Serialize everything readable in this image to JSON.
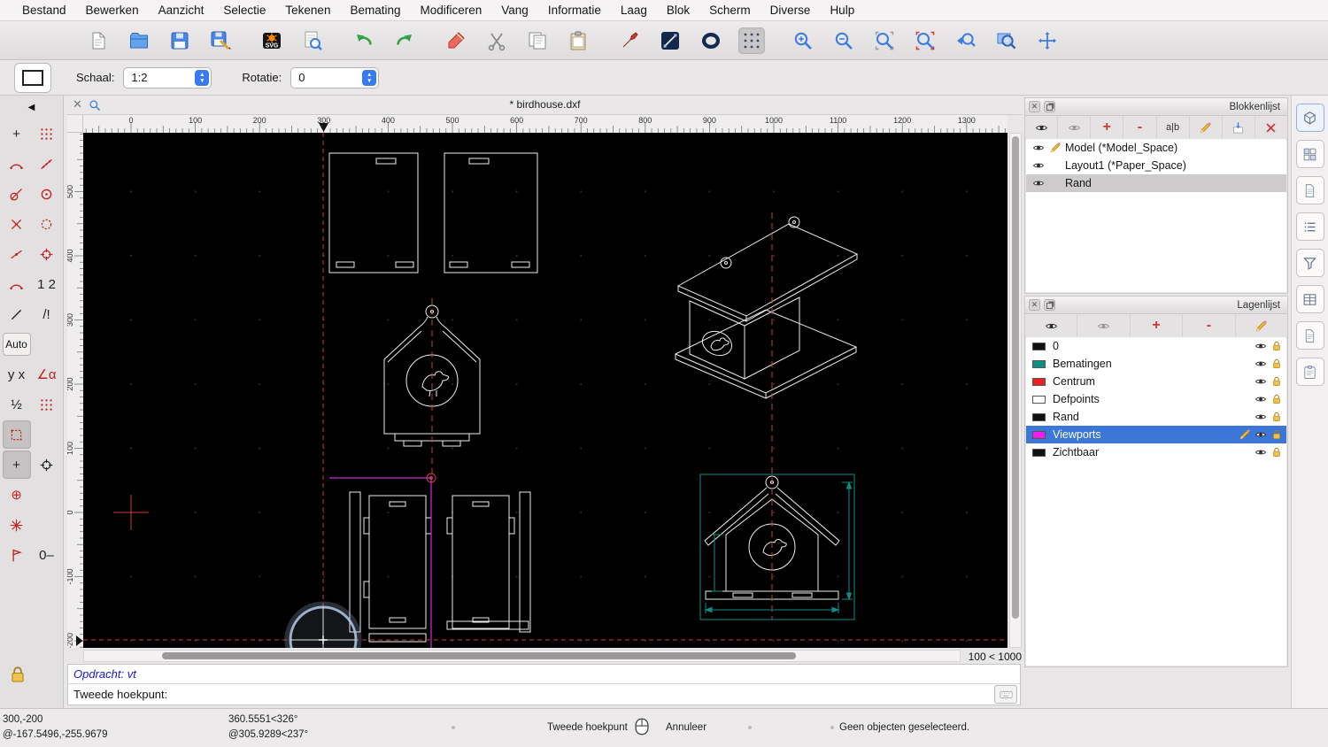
{
  "colors": {
    "accent": "#3a7af0",
    "selection_blue": "#3b76d8",
    "selection_gray": "#cdcbcb",
    "canvas_bg": "#000000",
    "entity_white": "#ededed",
    "centerline_red": "#d23b3b",
    "viewport_magenta": "#cc2fd4",
    "dimension_teal": "#0e8f84"
  },
  "menubar": {
    "items": [
      "Bestand",
      "Bewerken",
      "Aanzicht",
      "Selectie",
      "Tekenen",
      "Bemating",
      "Modificeren",
      "Vang",
      "Informatie",
      "Laag",
      "Blok",
      "Scherm",
      "Diverse",
      "Hulp"
    ]
  },
  "toolbar": {
    "buttons": [
      {
        "name": "new-file",
        "icon": "page"
      },
      {
        "name": "open-file",
        "icon": "folder"
      },
      {
        "name": "save-file",
        "icon": "floppy"
      },
      {
        "name": "save-as",
        "icon": "floppypen"
      },
      {
        "name": "export-svg",
        "icon": "svgbadge",
        "sep": true
      },
      {
        "name": "print-preview",
        "icon": "preview"
      },
      {
        "name": "undo",
        "icon": "undo",
        "sep": true
      },
      {
        "name": "redo",
        "icon": "redo"
      },
      {
        "name": "draw-highlight",
        "icon": "penred",
        "sep": true
      },
      {
        "name": "cut",
        "icon": "scissors"
      },
      {
        "name": "copy",
        "icon": "copy"
      },
      {
        "name": "paste",
        "icon": "clipboard"
      },
      {
        "name": "pen-tool",
        "icon": "pen2",
        "sep": true
      },
      {
        "name": "line-tool",
        "icon": "linebox"
      },
      {
        "name": "ellipse-tool",
        "icon": "ellipsebox"
      },
      {
        "name": "grid-toggle",
        "icon": "griddots",
        "active": true
      },
      {
        "name": "zoom-in",
        "icon": "zoomin",
        "sep": true
      },
      {
        "name": "zoom-out",
        "icon": "zoomout"
      },
      {
        "name": "zoom-auto",
        "icon": "zoomfit"
      },
      {
        "name": "zoom-reference",
        "icon": "zoomref"
      },
      {
        "name": "zoom-previous",
        "icon": "zoomprev"
      },
      {
        "name": "zoom-window",
        "icon": "zoomwin"
      },
      {
        "name": "pan",
        "icon": "pan"
      }
    ]
  },
  "options_bar": {
    "scale_label": "Schaal:",
    "scale_value": "1:2",
    "rotation_label": "Rotatie:",
    "rotation_value": "0"
  },
  "palette": {
    "back_arrow": "◀",
    "cells": [
      {
        "name": "snap-free",
        "text": "+",
        "color": "black"
      },
      {
        "name": "snap-grid",
        "icon": "p-dots",
        "color": "red"
      },
      {
        "name": "snap-endpoint",
        "icon": "p-arc",
        "color": "red"
      },
      {
        "name": "snap-on-entity",
        "icon": "p-entity",
        "color": "red"
      },
      {
        "name": "snap-perpendicular",
        "icon": "p-tangent",
        "color": "red"
      },
      {
        "name": "snap-center",
        "icon": "p-circledot",
        "color": "red"
      },
      {
        "name": "snap-intersection",
        "icon": "p-cross",
        "color": "red"
      },
      {
        "name": "snap-distance",
        "icon": "p-dashcircle",
        "color": "red"
      },
      {
        "name": "snap-middle",
        "icon": "p-middot",
        "color": "red"
      },
      {
        "name": "snap-coordinate",
        "icon": "p-target",
        "color": "red"
      },
      {
        "name": "restrict-nothing",
        "icon": "p-arc",
        "color": "red"
      },
      {
        "name": "snap-order",
        "text": "1 2",
        "color": "black"
      },
      {
        "name": "snap-filter",
        "icon": "p-slash",
        "color": "black"
      },
      {
        "name": "snap-exclude",
        "text": "/!",
        "color": "black"
      },
      {
        "name": "auto-snap",
        "text": "Auto",
        "auto": true
      },
      {
        "name": "spacer-1",
        "spacer": true
      },
      {
        "name": "coord-cartesian",
        "text": "y x",
        "color": "black"
      },
      {
        "name": "coord-polar",
        "text": "∠α",
        "color": "red"
      },
      {
        "name": "unit-fraction",
        "text": "½",
        "color": "black"
      },
      {
        "name": "grid-points",
        "icon": "p-dots",
        "color": "red"
      },
      {
        "name": "select-region",
        "icon": "p-dashsquare",
        "color": "red",
        "active": true
      },
      {
        "name": "spacer-2",
        "spacer": true
      },
      {
        "name": "tool-plus",
        "text": "+",
        "color": "black",
        "active": true
      },
      {
        "name": "tool-crosshair",
        "icon": "p-target",
        "color": "black"
      },
      {
        "name": "tool-circle-plus",
        "text": "⊕",
        "color": "red"
      },
      {
        "name": "spacer-3",
        "spacer": true
      },
      {
        "name": "tool-rays",
        "icon": "p-star",
        "color": "red"
      },
      {
        "name": "spacer-4",
        "spacer": true
      },
      {
        "name": "tool-flag",
        "icon": "p-flag",
        "color": "red"
      },
      {
        "name": "tool-zero-lock",
        "text": "0–",
        "color": "black"
      }
    ]
  },
  "document": {
    "title": "* birdhouse.dxf"
  },
  "rulers": {
    "horizontal": [
      "0",
      "100",
      "200",
      "300",
      "400",
      "500",
      "600",
      "700",
      "800",
      "900",
      "1000",
      "1100",
      "1200",
      "1300"
    ],
    "vertical": [
      "500",
      "400",
      "300",
      "200",
      "100",
      "0",
      "-100",
      "-200"
    ]
  },
  "canvas": {
    "zoom_indicator": "100 < 1000"
  },
  "command_line": {
    "history": "Opdracht: vt",
    "prompt": "Tweede hoekpunt:"
  },
  "status_bar": {
    "abs_coord": "300,-200",
    "rel_coord": "@-167.5496,-255.9679",
    "polar_abs": "360.5551<326°",
    "polar_rel": "@305.9289<237°",
    "mouse_left_action": "Tweede hoekpunt",
    "mouse_right_action": "Annuleer",
    "selection_status": "Geen objecten geselecteerd."
  },
  "block_list": {
    "title": "Blokkenlijst",
    "toolbar": [
      {
        "name": "show-all-blocks",
        "icon": "eye"
      },
      {
        "name": "hide-all-blocks",
        "icon": "eyegray"
      },
      {
        "name": "add-block",
        "text": "+",
        "red": true
      },
      {
        "name": "remove-block",
        "text": "-",
        "red": true
      },
      {
        "name": "rename-block",
        "text": "a|b"
      },
      {
        "name": "edit-block",
        "icon": "pencil"
      },
      {
        "name": "insert-block",
        "icon": "insert"
      },
      {
        "name": "delete-block",
        "icon": "xred"
      }
    ],
    "items": [
      {
        "name": "Model (*Model_Space)",
        "editable": true,
        "selected": false
      },
      {
        "name": "Layout1 (*Paper_Space)",
        "editable": false,
        "selected": false
      },
      {
        "name": "Rand",
        "editable": false,
        "selected": true
      }
    ]
  },
  "layer_list": {
    "title": "Lagenlijst",
    "toolbar": [
      {
        "name": "show-all-layers",
        "icon": "eye"
      },
      {
        "name": "hide-all-layers",
        "icon": "eyegray"
      },
      {
        "name": "add-layer",
        "text": "+",
        "red": true
      },
      {
        "name": "remove-layer",
        "text": "-",
        "red": true
      },
      {
        "name": "edit-layer",
        "icon": "pencil"
      }
    ],
    "layers": [
      {
        "name": "0",
        "color": "#111111",
        "selected": false,
        "editable": false
      },
      {
        "name": "Bematingen",
        "color": "#0e8f84",
        "selected": false,
        "editable": false
      },
      {
        "name": "Centrum",
        "color": "#e82222",
        "selected": false,
        "editable": false
      },
      {
        "name": "Defpoints",
        "color": "#ffffff",
        "selected": false,
        "editable": false
      },
      {
        "name": "Rand",
        "color": "#111111",
        "selected": false,
        "editable": false
      },
      {
        "name": "Viewports",
        "color": "#f31df3",
        "selected": true,
        "editable": true
      },
      {
        "name": "Zichtbaar",
        "color": "#111111",
        "selected": false,
        "editable": false
      }
    ]
  },
  "right_strip": {
    "buttons": [
      {
        "name": "toggle-library-browser",
        "icon": "cube"
      },
      {
        "name": "toggle-block-list",
        "icon": "blocks"
      },
      {
        "name": "toggle-command-history",
        "icon": "sheet"
      },
      {
        "name": "toggle-layer-list",
        "icon": "list"
      },
      {
        "name": "toggle-selection-filter",
        "icon": "funnel"
      },
      {
        "name": "toggle-property-editor",
        "icon": "columns"
      },
      {
        "name": "toggle-notes",
        "icon": "sheet"
      },
      {
        "name": "toggle-clipboard-panel",
        "icon": "clip"
      }
    ]
  }
}
